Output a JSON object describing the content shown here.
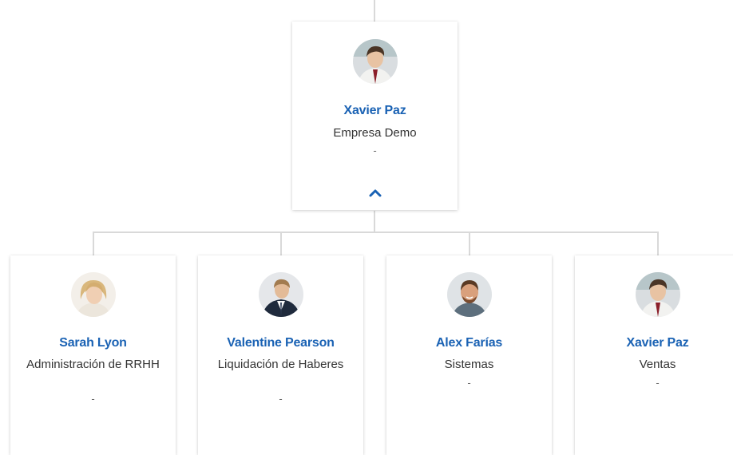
{
  "root": {
    "name": "Xavier Paz",
    "department": "Empresa Demo",
    "extra": "-",
    "toggle_icon": "chevron-up-icon"
  },
  "children": [
    {
      "name": "Sarah Lyon",
      "department": "Administración de RRHH",
      "extra": "-"
    },
    {
      "name": "Valentine Pearson",
      "department": "Liquidación de Haberes",
      "extra": "-"
    },
    {
      "name": "Alex Farías",
      "department": "Sistemas",
      "extra": "-"
    },
    {
      "name": "Xavier Paz",
      "department": "Ventas",
      "extra": "-"
    }
  ],
  "colors": {
    "accent": "#1a62b4",
    "connector": "#d9d9d9"
  }
}
